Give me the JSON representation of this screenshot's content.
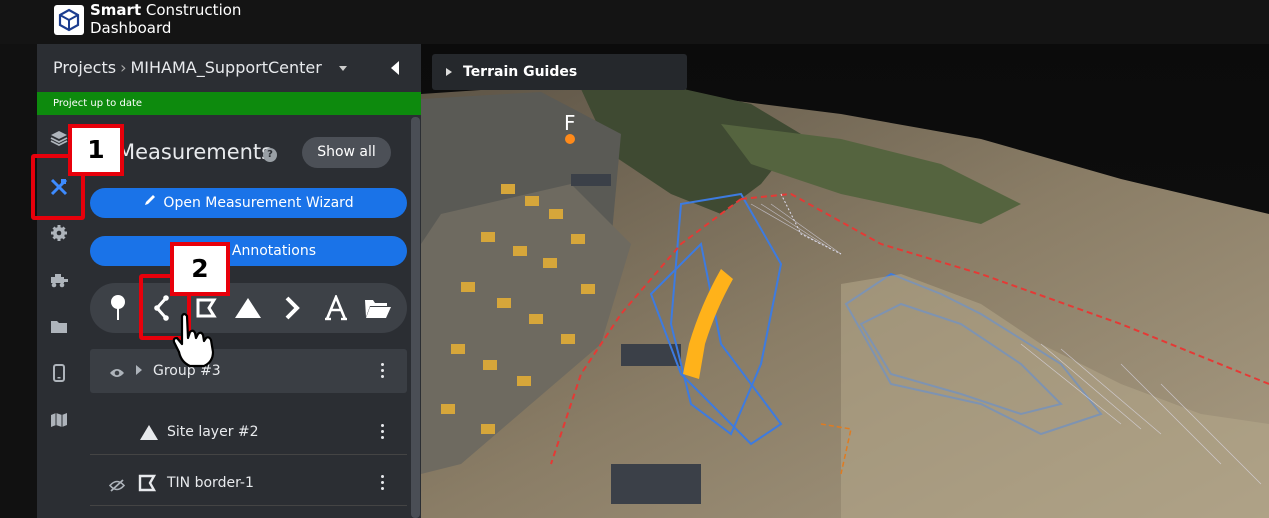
{
  "app": {
    "brand_line1_bold": "Smart",
    "brand_line1_rest": "Construction",
    "brand_line2": "Dashboard"
  },
  "breadcrumb": {
    "root": "Projects",
    "separator": "›",
    "project": "MIHAMA_SupportCenter"
  },
  "status": {
    "text": "Project up to date",
    "color": "#0d8a0d"
  },
  "rail_icons": [
    "layers-icon",
    "measure-tools-icon",
    "gear-icon",
    "machine-icon",
    "folder-icon",
    "mobile-icon",
    "map-icon"
  ],
  "measurements": {
    "title": "Measurements",
    "show_all": "Show all",
    "wizard_button": "Open Measurement Wizard",
    "annotations_button": "Import Annotations",
    "tools": [
      "point-marker-icon",
      "polyline-icon",
      "tin-border-icon",
      "triangle-surface-icon",
      "chevron-arrow-icon",
      "text-icon",
      "folder-open-icon"
    ]
  },
  "list": [
    {
      "label": "Group #3",
      "type": "group"
    },
    {
      "label": "Site layer #2",
      "type": "layer"
    },
    {
      "label": "TIN border-1",
      "type": "layer"
    }
  ],
  "viewport": {
    "terrain_guides": "Terrain Guides",
    "marker_label": "F"
  },
  "callouts": {
    "one": "1",
    "two": "2"
  },
  "colors": {
    "accent": "#1a73e8",
    "callout_red": "#e8000b",
    "panel": "#2b2e33"
  }
}
